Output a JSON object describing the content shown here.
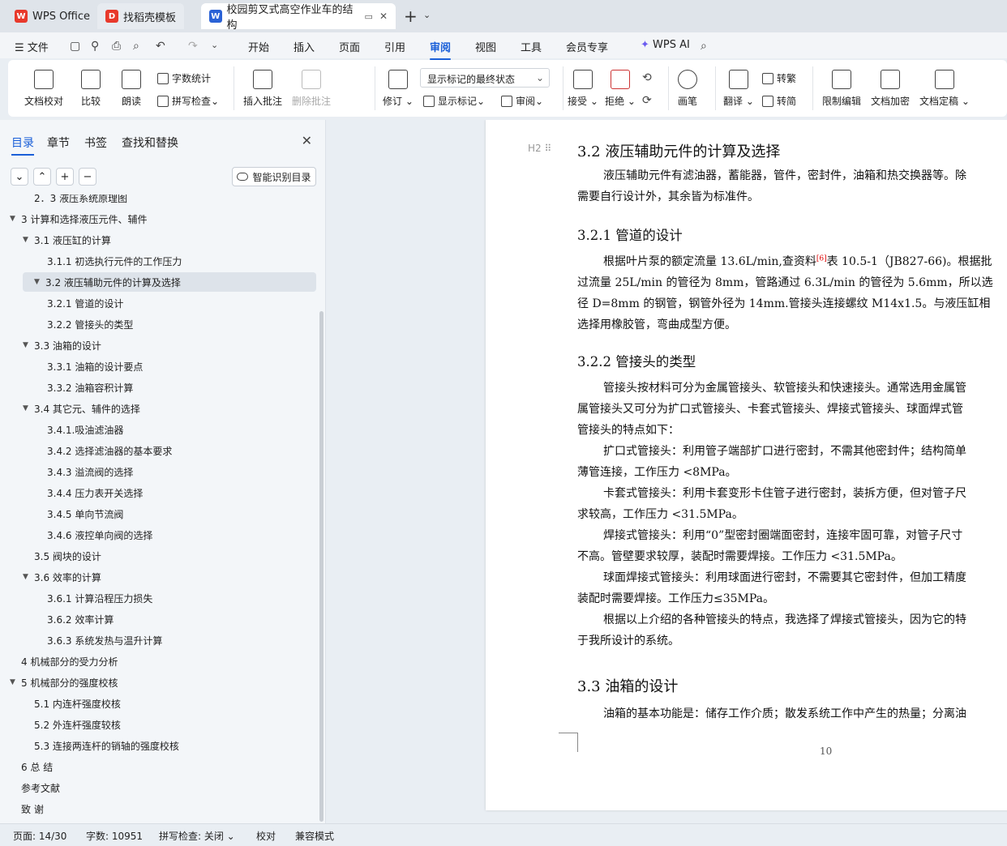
{
  "tabs": [
    {
      "label": "WPS Office",
      "icon": "wps-logo-icon",
      "color": "#e8392b"
    },
    {
      "label": "找稻壳模板",
      "icon": "docer-icon",
      "color": "#e8392b"
    },
    {
      "label": "校园剪叉式高空作业车的结构",
      "icon": "word-doc-icon",
      "color": "#2a62d6"
    }
  ],
  "menu": {
    "file": "文件",
    "items": [
      "开始",
      "插入",
      "页面",
      "引用",
      "审阅",
      "视图",
      "工具",
      "会员专享"
    ],
    "active": "审阅",
    "ai": "WPS AI"
  },
  "ribbon": {
    "proofread": "文档校对",
    "compare": "比较",
    "read_aloud": "朗读",
    "word_count": "字数统计",
    "spell_check": "拼写检查",
    "insert_comment": "插入批注",
    "delete_comment": "删除批注",
    "revise": "修订",
    "markup_state": "显示标记的最终状态",
    "show_markup": "显示标记",
    "review": "审阅",
    "accept": "接受",
    "reject": "拒绝",
    "pen": "画笔",
    "translate": "翻译",
    "to_traditional": "转繁",
    "to_simplified": "转简",
    "restrict_edit": "限制编辑",
    "encrypt": "文档加密",
    "finalize": "文档定稿"
  },
  "nav_panel": {
    "tabs": [
      "目录",
      "章节",
      "书签",
      "查找和替换"
    ],
    "active_tab": "目录",
    "smart_button": "智能识别目录",
    "items": [
      {
        "level": 2,
        "label": "2．3 液压系统原理图",
        "caret": false
      },
      {
        "level": 1,
        "label": "3 计算和选择液压元件、辅件",
        "caret": true
      },
      {
        "level": 2,
        "label": "3.1 液压缸的计算",
        "caret": true
      },
      {
        "level": 3,
        "label": "3.1.1 初选执行元件的工作压力",
        "caret": false
      },
      {
        "level": 2,
        "label": "3.2  液压辅助元件的计算及选择",
        "caret": true,
        "selected": true
      },
      {
        "level": 3,
        "label": "3.2.1 管道的设计",
        "caret": false
      },
      {
        "level": 3,
        "label": "3.2.2 管接头的类型",
        "caret": false
      },
      {
        "level": 2,
        "label": "3.3 油箱的设计",
        "caret": true
      },
      {
        "level": 3,
        "label": "3.3.1 油箱的设计要点",
        "caret": false
      },
      {
        "level": 3,
        "label": "3.3.2 油箱容积计算",
        "caret": false
      },
      {
        "level": 2,
        "label": "3.4    其它元、辅件的选择",
        "caret": true
      },
      {
        "level": 3,
        "label": "3.4.1.吸油滤油器",
        "caret": false
      },
      {
        "level": 3,
        "label": "3.4.2 选择滤油器的基本要求",
        "caret": false
      },
      {
        "level": 3,
        "label": "3.4.3 溢流阀的选择",
        "caret": false
      },
      {
        "level": 3,
        "label": "3.4.4 压力表开关选择",
        "caret": false
      },
      {
        "level": 3,
        "label": "3.4.5 单向节流阀",
        "caret": false
      },
      {
        "level": 3,
        "label": "3.4.6  液控单向阀的选择",
        "caret": false
      },
      {
        "level": 2,
        "label": "3.5 阀块的设计",
        "caret": false
      },
      {
        "level": 2,
        "label": "3.6  效率的计算",
        "caret": true
      },
      {
        "level": 3,
        "label": "3.6.1 计算沿程压力损失",
        "caret": false
      },
      {
        "level": 3,
        "label": "3.6.2 效率计算",
        "caret": false
      },
      {
        "level": 3,
        "label": "3.6.3 系统发热与温升计算",
        "caret": false
      },
      {
        "level": 1,
        "label": "4 机械部分的受力分析",
        "caret": false
      },
      {
        "level": 1,
        "label": "5  机械部分的强度校核",
        "caret": true
      },
      {
        "level": 2,
        "label": "5.1  内连杆强度校核",
        "caret": false
      },
      {
        "level": 2,
        "label": "5.2  外连杆强度较核",
        "caret": false
      },
      {
        "level": 2,
        "label": "5.3  连接两连杆的销轴的强度校核",
        "caret": false
      },
      {
        "level": 1,
        "label": "6 总    结",
        "caret": false
      },
      {
        "level": 1,
        "label": "参考文献",
        "caret": false
      },
      {
        "level": 1,
        "label": "致    谢",
        "caret": false
      }
    ]
  },
  "document": {
    "heading_mark": "H2",
    "h_3_2": "3.2  液压辅助元件的计算及选择",
    "p1_l1": "液压辅助元件有滤油器，蓄能器，管件，密封件，油箱和热交换器等。除",
    "p1_l2": "需要自行设计外，其余皆为标准件。",
    "h_3_2_1": "3.2.1 管道的设计",
    "p2_l1a": "根据叶片泵的额定流量 13.6L/min,查资料",
    "p2_ref": "[6]",
    "p2_l1b": "表 10.5-1（JB827-66)。根据批",
    "p2_l2": "过流量 25L/min 的管径为 8mm，管路通过 6.3L/min 的管径为 5.6mm，所以选",
    "p2_l3": "径 D=8mm 的钢管，钢管外径为 14mm.管接头连接螺纹 M14x1.5。与液压缸相",
    "p2_l4": "选择用橡胶管，弯曲成型方便。",
    "h_3_2_2": "3.2.2 管接头的类型",
    "p3_l1": "管接头按材料可分为金属管接头、软管接头和快速接头。通常选用金属管",
    "p3_l2": "属管接头又可分为扩口式管接头、卡套式管接头、焊接式管接头、球面焊式管",
    "p3_l3": "管接头的特点如下：",
    "p4_l1": "扩口式管接头：利用管子端部扩口进行密封，不需其他密封件；结构简单",
    "p4_l2": "薄管连接，工作压力 <8MPa。",
    "p5_l1": "卡套式管接头：利用卡套变形卡住管子进行密封，装拆方便，但对管子尺",
    "p5_l2": "求较高，工作压力 <31.5MPa。",
    "p6_l1": "焊接式管接头：利用“0”型密封圈端面密封，连接牢固可靠，对管子尺寸",
    "p6_l2": "不高。管壁要求较厚，装配时需要焊接。工作压力 <31.5MPa。",
    "p7_l1": "球面焊接式管接头：利用球面进行密封，不需要其它密封件，但加工精度",
    "p7_l2": "装配时需要焊接。工作压力≤35MPa。",
    "p8_l1": "根据以上介绍的各种管接头的特点，我选择了焊接式管接头，因为它的特",
    "p8_l2": "于我所设计的系统。",
    "h_3_3": "3.3 油箱的设计",
    "p9_l1": "油箱的基本功能是：储存工作介质；散发系统工作中产生的热量；分离油",
    "page_number": "10"
  },
  "status": {
    "page": "页面: 14/30",
    "words": "字数: 10951",
    "spell": "拼写检查: 关闭",
    "proof": "校对",
    "compat": "兼容模式"
  },
  "colors": {
    "accent": "#1a5fd8",
    "ref_red": "#dd0000"
  }
}
